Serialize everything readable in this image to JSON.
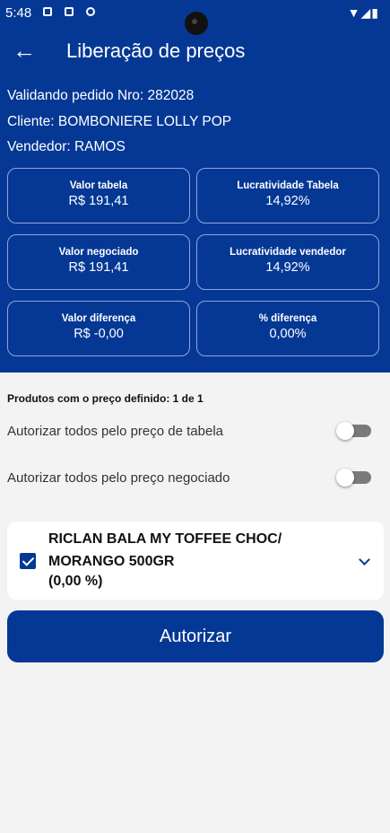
{
  "status_bar": {
    "time": "5:48",
    "icons": [
      "notification-icon",
      "calendar-icon",
      "app-icon",
      "wifi-icon",
      "signal-icon",
      "battery-icon"
    ]
  },
  "header": {
    "title": "Liberação de preços",
    "order_line": "Validando pedido Nro: 282028",
    "client_line": "Cliente: BOMBONIERE LOLLY POP",
    "seller_line": "Vendedor: RAMOS"
  },
  "cards": [
    {
      "label": "Valor tabela",
      "value": "R$ 191,41"
    },
    {
      "label": "Lucratividade Tabela",
      "value": "14,92%"
    },
    {
      "label": "Valor negociado",
      "value": "R$ 191,41"
    },
    {
      "label": "Lucratividade vendedor",
      "value": "14,92%"
    },
    {
      "label": "Valor diferença",
      "value": "R$ -0,00"
    },
    {
      "label": "% diferença",
      "value": "0,00%"
    }
  ],
  "products_title": "Produtos com o preço definido: 1 de 1",
  "toggles": [
    {
      "label": "Autorizar todos pelo preço de tabela",
      "on": false
    },
    {
      "label": "Autorizar todos pelo preço negociado",
      "on": false
    }
  ],
  "product": {
    "name": "RICLAN BALA MY TOFFEE CHOC/ MORANGO 500GR",
    "percent": "(0,00 %)",
    "checked": true
  },
  "authorize_button": "Autorizar",
  "colors": {
    "primary": "#053895",
    "background": "#f3f3f3"
  }
}
